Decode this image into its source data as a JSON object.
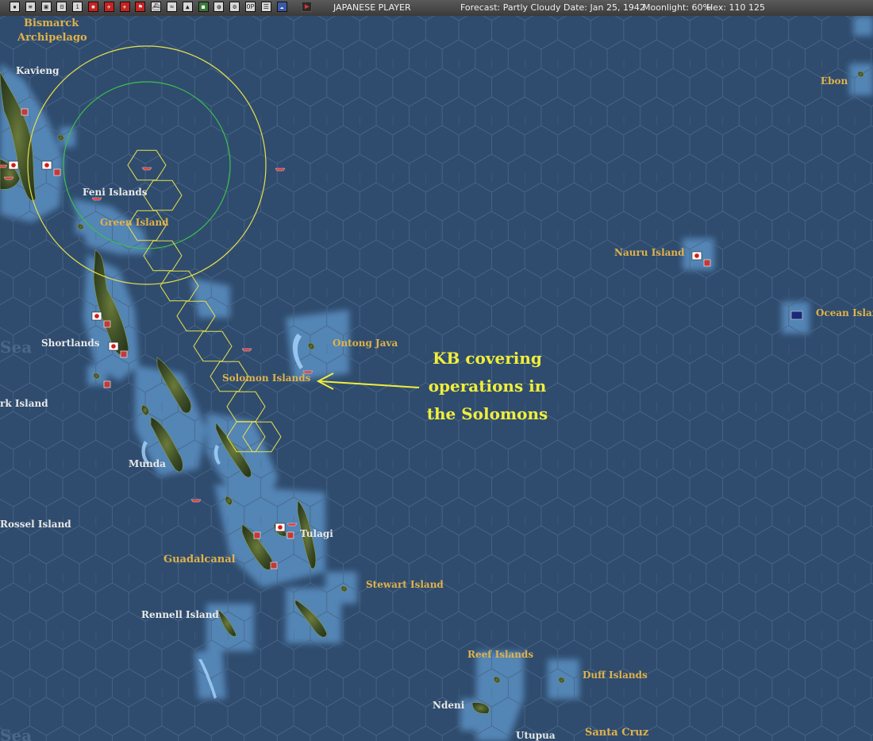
{
  "toolbar": {
    "buttons": [
      {
        "icon": "menu-icon"
      },
      {
        "icon": "report-icon"
      },
      {
        "icon": "bases-icon"
      },
      {
        "icon": "ships-icon"
      },
      {
        "icon": "info-icon",
        "text": "i"
      },
      {
        "icon": "rising-sun-icon"
      },
      {
        "icon": "air-icon"
      },
      {
        "icon": "allied-air-icon"
      },
      {
        "icon": "flag-icon"
      },
      {
        "icon": "fleet-icon"
      },
      {
        "icon": "convoy-icon"
      },
      {
        "icon": "terrain-icon"
      },
      {
        "icon": "ground-icon"
      },
      {
        "icon": "globe-icon"
      },
      {
        "icon": "settings-icon"
      },
      {
        "icon": "op-icon",
        "text": "OP"
      },
      {
        "icon": "list-icon"
      },
      {
        "icon": "weather-icon"
      },
      {
        "icon": "end-turn-icon"
      }
    ],
    "player": "JAPANESE PLAYER",
    "forecast": "Forecast: Partly Cloudy",
    "date": "Date: Jan 25, 1942",
    "moonlight": "Moonlight: 60%",
    "hex": "Hex: 110 125"
  },
  "labels": {
    "bismarck_1": "Bismarck",
    "bismarck_2": "Archipelago",
    "kavieng": "Kavieng",
    "feni": "Feni Islands",
    "green": "Green Island",
    "ebon": "Ebon",
    "nauru": "Nauru Island",
    "ocean": "Ocean Island",
    "ontong": "Ontong Java",
    "shortlands": "Shortlands",
    "sea": "Sea",
    "solomon": "Solomon Islands",
    "clark": "rk Island",
    "munda": "Munda",
    "rossel": "Rossel Island",
    "tulagi": "Tulagi",
    "guadalcanal": "Guadalcanal",
    "stewart": "Stewart Island",
    "rennell": "Rennell Island",
    "reef": "Reef Islands",
    "duff": "Duff Islands",
    "ndeni": "Ndeni",
    "utupua": "Utupua",
    "santacruz": "Santa Cruz",
    "sea_bottom": "Sea"
  },
  "annotation": {
    "line1": "KB covering",
    "line2": "operations in",
    "line3": "the Solomons"
  },
  "colors": {
    "ocean": "#2f4c6e",
    "shallow": "#5a8fc2",
    "land": "#4a5a2e",
    "range_outer": "#e8e04a",
    "range_inner": "#3ac24a",
    "annotation": "#f2ee3a",
    "japan_flag": "#d81818",
    "enemy_base": "#c03a3a"
  }
}
